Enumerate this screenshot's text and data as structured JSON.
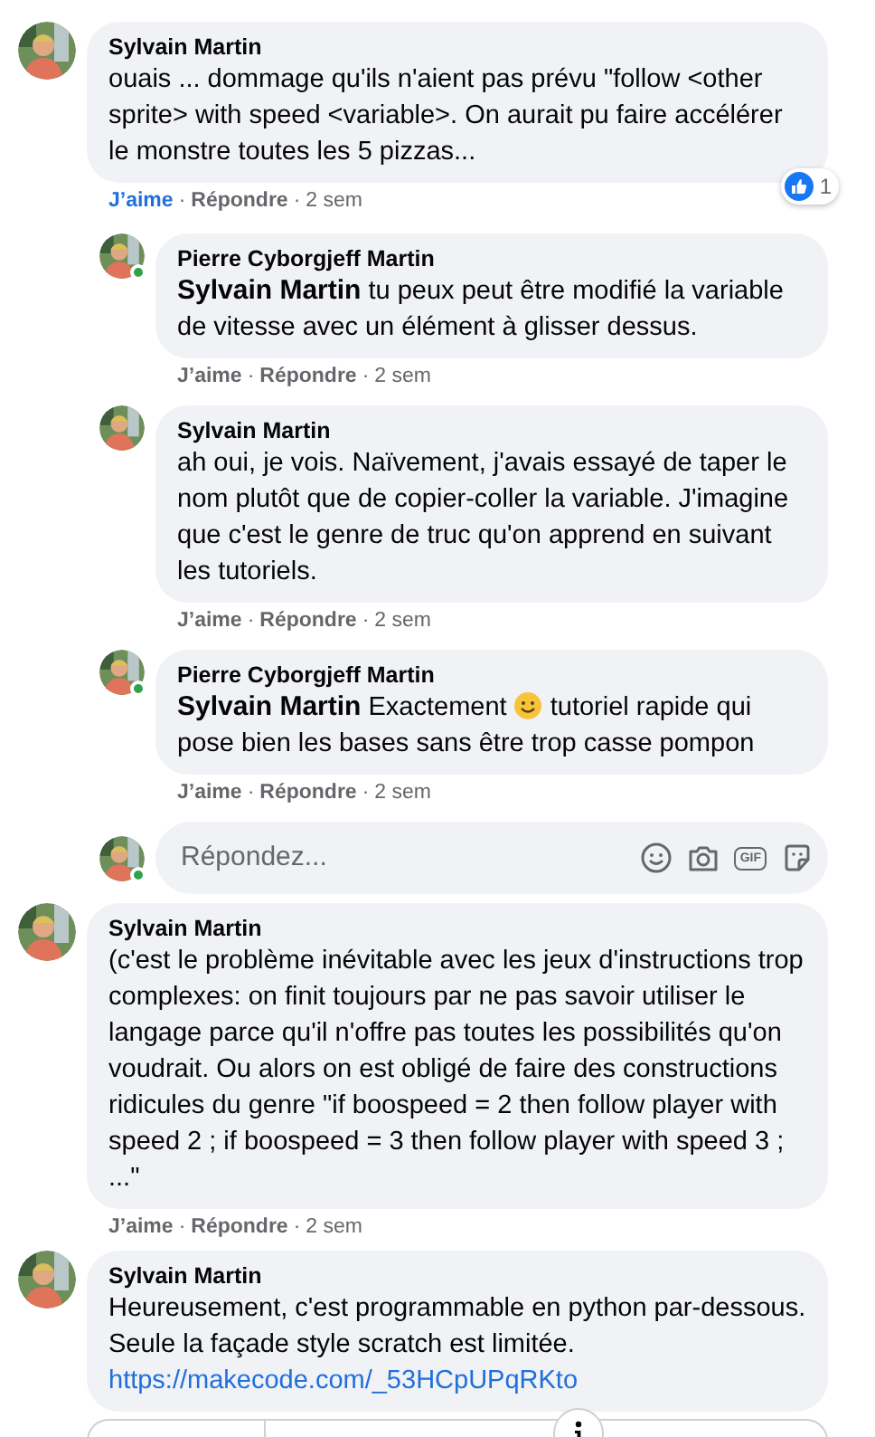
{
  "comments": [
    {
      "author": "Sylvain Martin",
      "parts": [
        {
          "kind": "text",
          "text": "ouais ... dommage qu'ils n'aient pas prévu \"follow <other sprite> with speed <variable>. On aurait pu faire accélérer le monstre toutes les 5 pizzas..."
        }
      ],
      "liked": true,
      "actions": [
        {
          "kind": "like",
          "text": "J’aime"
        },
        {
          "kind": "dot",
          "text": "·"
        },
        {
          "kind": "reply",
          "text": "Répondre"
        },
        {
          "kind": "dot",
          "text": "·"
        },
        {
          "kind": "time",
          "text": "2 sem"
        }
      ],
      "reactions": "1",
      "replies": [
        {
          "author": "Pierre Cyborgjeff Martin",
          "online": true,
          "mention": "Sylvain Martin",
          "parts": [
            {
              "kind": "text",
              "text": "tu peux peut être modifié la variable de vitesse avec un élément à glisser dessus."
            }
          ],
          "liked": false,
          "actions": [
            {
              "kind": "like",
              "text": "J’aime"
            },
            {
              "kind": "dot",
              "text": "·"
            },
            {
              "kind": "reply",
              "text": "Répondre"
            },
            {
              "kind": "dot",
              "text": "·"
            },
            {
              "kind": "time",
              "text": "2 sem"
            }
          ]
        },
        {
          "author": "Sylvain Martin",
          "parts": [
            {
              "kind": "text",
              "text": "ah oui, je vois. Naïvement, j'avais essayé de taper le nom plutôt que de copier-coller la variable. J'imagine que c'est le genre de truc qu'on apprend en suivant les tutoriels."
            }
          ],
          "liked": false,
          "actions": [
            {
              "kind": "like",
              "text": "J’aime"
            },
            {
              "kind": "dot",
              "text": "·"
            },
            {
              "kind": "reply",
              "text": "Répondre"
            },
            {
              "kind": "dot",
              "text": "·"
            },
            {
              "kind": "time",
              "text": "2 sem"
            }
          ]
        },
        {
          "author": "Pierre Cyborgjeff Martin",
          "online": true,
          "mention": "Sylvain Martin",
          "parts": [
            {
              "kind": "text",
              "text": "Exactement"
            },
            {
              "kind": "emoji"
            },
            {
              "kind": "text",
              "text": "tutoriel rapide qui pose bien les bases sans être trop casse pompon"
            }
          ],
          "liked": false,
          "actions": [
            {
              "kind": "like",
              "text": "J’aime"
            },
            {
              "kind": "dot",
              "text": "·"
            },
            {
              "kind": "reply",
              "text": "Répondre"
            },
            {
              "kind": "dot",
              "text": "·"
            },
            {
              "kind": "time",
              "text": "2 sem"
            }
          ]
        }
      ],
      "reply_box": {
        "online": true,
        "placeholder": "Répondez...",
        "gif_label": "GIF"
      }
    },
    {
      "author": "Sylvain Martin",
      "parts": [
        {
          "kind": "text",
          "text": "(c'est le problème inévitable avec les jeux d'instructions trop complexes: on finit toujours par ne pas savoir utiliser le langage parce qu'il n'offre pas toutes les possibilités qu'on voudrait. Ou alors on est obligé de faire des constructions ridicules du genre \"if boospeed = 2 then follow player with speed 2 ; if boospeed = 3 then follow player with speed 3 ; ...\""
        }
      ],
      "liked": false,
      "actions": [
        {
          "kind": "like",
          "text": "J’aime"
        },
        {
          "kind": "dot",
          "text": "·"
        },
        {
          "kind": "reply",
          "text": "Répondre"
        },
        {
          "kind": "dot",
          "text": "·"
        },
        {
          "kind": "time",
          "text": "2 sem"
        }
      ]
    },
    {
      "author": "Sylvain Martin",
      "parts": [
        {
          "kind": "text",
          "text": "Heureusement, c'est programmable en python par-dessous. Seule la façade style scratch est limitée."
        },
        {
          "kind": "link",
          "text": "https://makecode.com/_53HCpUPqRKto"
        }
      ],
      "link_preview": true
    }
  ]
}
